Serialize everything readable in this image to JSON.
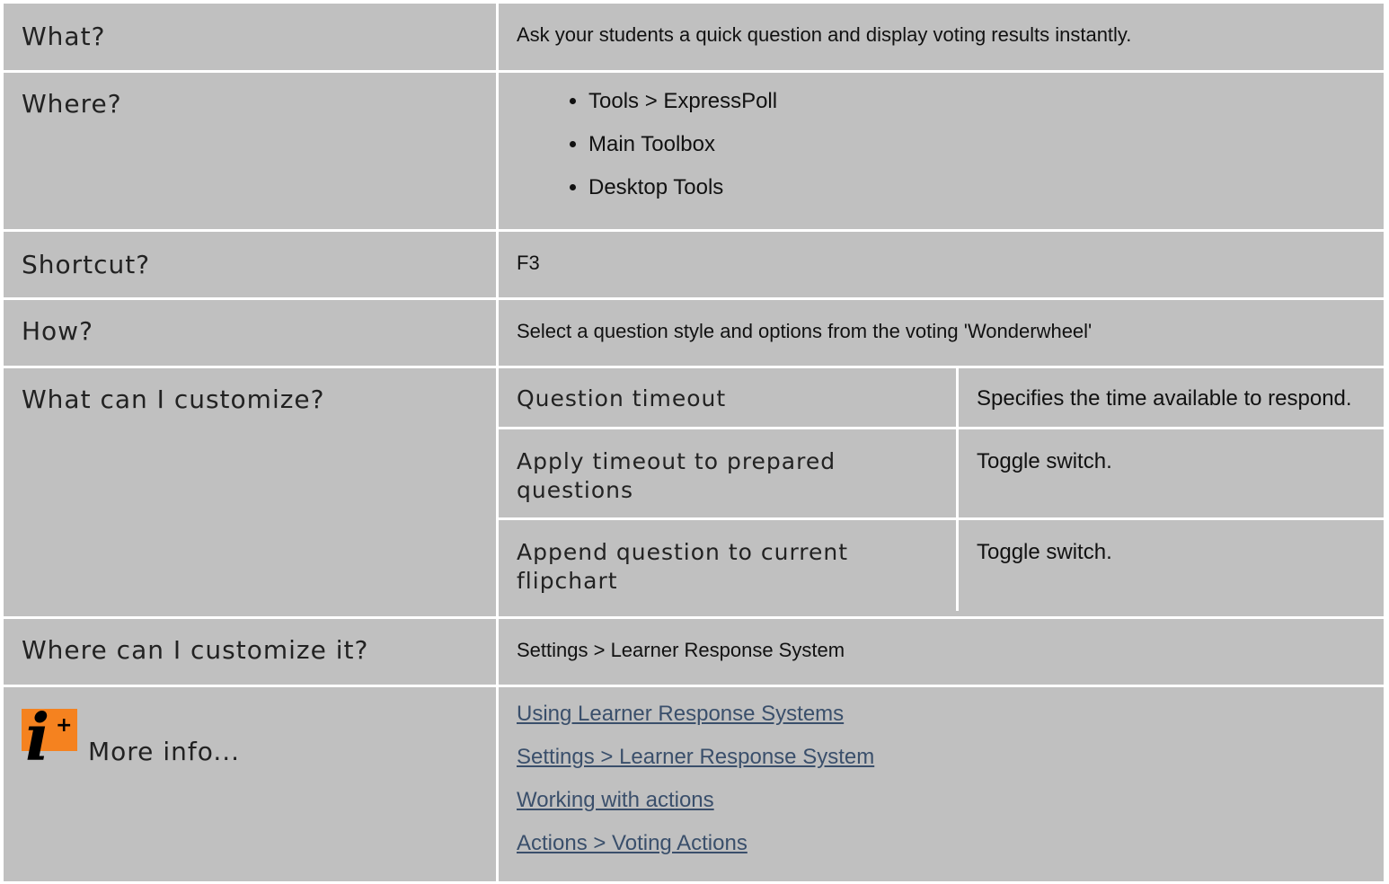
{
  "rows": {
    "what": {
      "label": "What?",
      "value": "Ask your students a quick question and display voting results instantly."
    },
    "where": {
      "label": "Where?",
      "items": [
        "Tools > ExpressPoll",
        "Main Toolbox",
        "Desktop Tools"
      ]
    },
    "shortcut": {
      "label": "Shortcut?",
      "value": "F3"
    },
    "how": {
      "label": "How?",
      "value": "Select a question style and options from the voting 'Wonderwheel'"
    },
    "customize": {
      "label": "What can I customize?",
      "options": [
        {
          "name": "Question timeout",
          "desc": "Specifies the time available to respond."
        },
        {
          "name": "Apply timeout to prepared questions",
          "desc": "Toggle switch."
        },
        {
          "name": "Append question to current flipchart",
          "desc": "Toggle switch."
        }
      ]
    },
    "where_customize": {
      "label": "Where can I customize it?",
      "value": "Settings > Learner Response System"
    },
    "more_info": {
      "label": "More info...",
      "icon": "info-plus-icon",
      "links": [
        "Using Learner Response Systems",
        "Settings > Learner Response System",
        "Working with actions",
        "Actions > Voting Actions"
      ]
    }
  },
  "colors": {
    "cell_bg": "#c0c0c0",
    "link": "#3a4f6b",
    "icon_orange": "#f5821f"
  }
}
